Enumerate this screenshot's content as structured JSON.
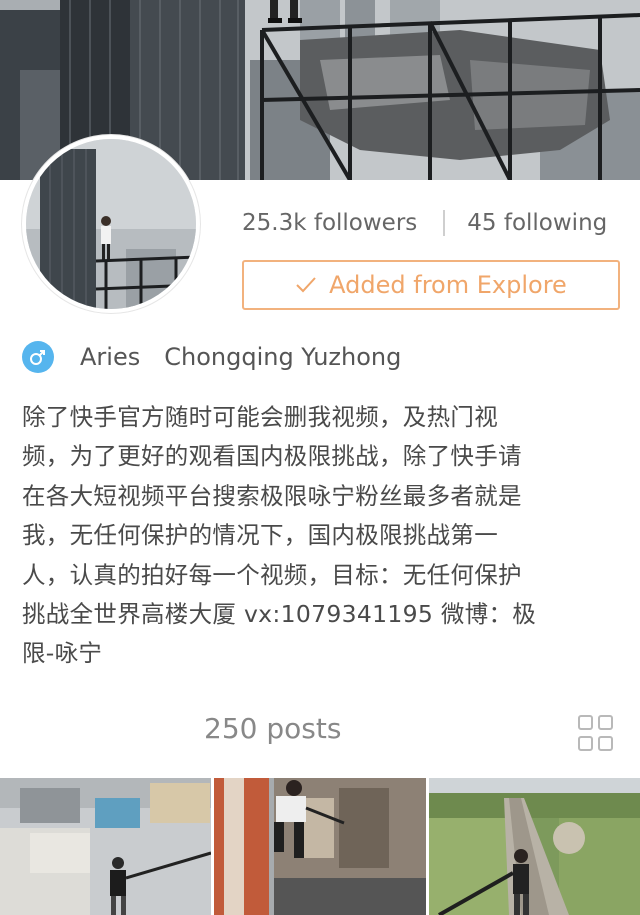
{
  "profile": {
    "followers": "25.3k followers",
    "following": "45 following",
    "added_label": "Added from Explore",
    "zodiac": "Aries",
    "location": "Chongqing Yuzhong",
    "bio": "除了快手官方随时可能会删我视频，及热门视频，为了更好的观看国内极限挑战，除了快手请在各大短视频平台搜索极限咏宁粉丝最多者就是我，无任何保护的情况下，国内极限挑战第一人，认真的拍好每一个视频，目标：无任何保护挑战全世界高楼大厦 vx:1079341195 微博：极限-咏宁",
    "bio_lines": [
      "除了快手官方随时可能会删我视频，及热门视",
      "频，为了更好的观看国内极限挑战，除了快手请",
      "在各大短视频平台搜索极限咏宁粉丝最多者就是",
      "我，无任何保护的情况下，国内极限挑战第一",
      "人，认真的拍好每一个视频，目标：无任何保护",
      "挑战全世界高楼大厦  vx:1079341195  微博：极",
      "限-咏宁"
    ],
    "posts": "250 posts"
  },
  "icons": {
    "gender": "male-symbol-icon",
    "check": "check-icon",
    "grid": "grid-view-icon"
  },
  "colors": {
    "accent_orange": "#f0a66a",
    "gender_blue": "#56b5ee",
    "text": "#4a4a4a"
  }
}
